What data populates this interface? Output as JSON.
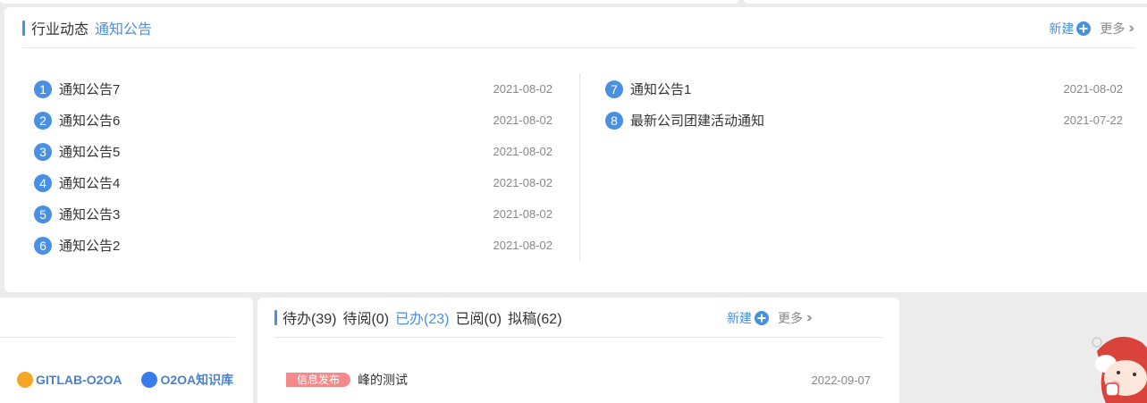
{
  "notices": {
    "tabs": [
      {
        "label": "行业动态",
        "active": false
      },
      {
        "label": "通知公告",
        "active": true
      }
    ],
    "new_label": "新建",
    "more_label": "更多",
    "left_items": [
      {
        "num": "1",
        "title": "通知公告7",
        "date": "2021-08-02"
      },
      {
        "num": "2",
        "title": "通知公告6",
        "date": "2021-08-02"
      },
      {
        "num": "3",
        "title": "通知公告5",
        "date": "2021-08-02"
      },
      {
        "num": "4",
        "title": "通知公告4",
        "date": "2021-08-02"
      },
      {
        "num": "5",
        "title": "通知公告3",
        "date": "2021-08-02"
      },
      {
        "num": "6",
        "title": "通知公告2",
        "date": "2021-08-02"
      }
    ],
    "right_items": [
      {
        "num": "7",
        "title": "通知公告1",
        "date": "2021-08-02"
      },
      {
        "num": "8",
        "title": "最新公司团建活动通知",
        "date": "2021-07-22"
      }
    ]
  },
  "links": [
    {
      "label": "GITLAB-O2OA",
      "color": "#f5a623"
    },
    {
      "label": "O2OA知识库",
      "color": "#3a7bea"
    }
  ],
  "tasks": {
    "tabs": [
      {
        "label": "待办(39)",
        "active": false
      },
      {
        "label": "待阅(0)",
        "active": false
      },
      {
        "label": "已办(23)",
        "active": true
      },
      {
        "label": "已阅(0)",
        "active": false
      },
      {
        "label": "拟稿(62)",
        "active": false
      }
    ],
    "new_label": "新建",
    "more_label": "更多",
    "items": [
      {
        "tag": "信息发布",
        "title": "峰的测试",
        "date": "2022-09-07"
      }
    ]
  },
  "colors": {
    "accent": "#4a90e2",
    "tag": "#f58a8a"
  }
}
